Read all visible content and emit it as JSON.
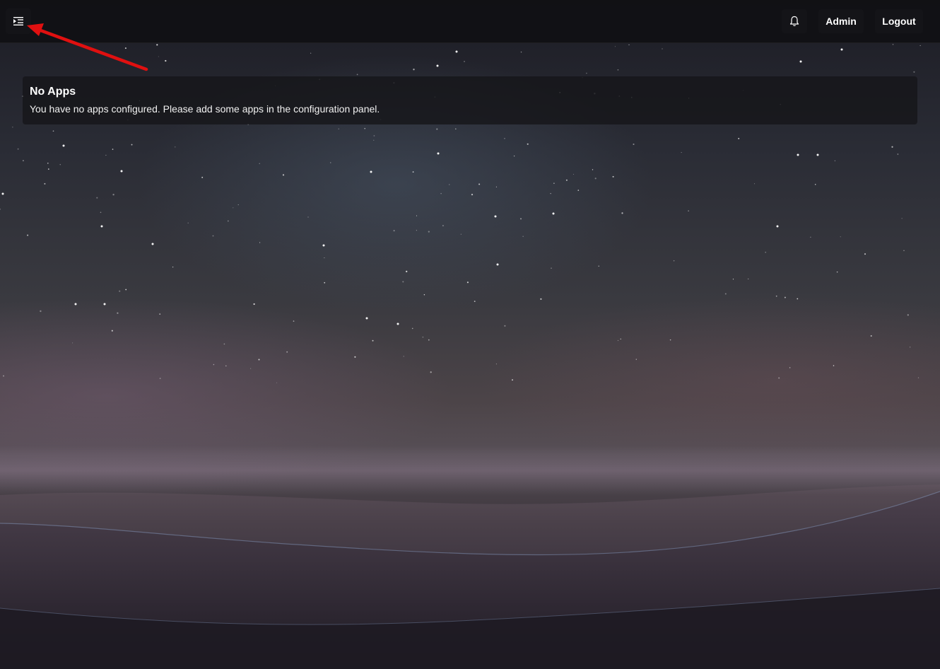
{
  "header": {
    "menu_icon": "indent-menu-icon",
    "bell_icon": "bell-icon",
    "admin_label": "Admin",
    "logout_label": "Logout"
  },
  "notice": {
    "title": "No Apps",
    "message": "You have no apps configured. Please add some apps in the configuration panel."
  },
  "colors": {
    "topbar": "#101014",
    "button": "#141418",
    "text": "#ffffff",
    "annotation_arrow": "#e01010"
  }
}
